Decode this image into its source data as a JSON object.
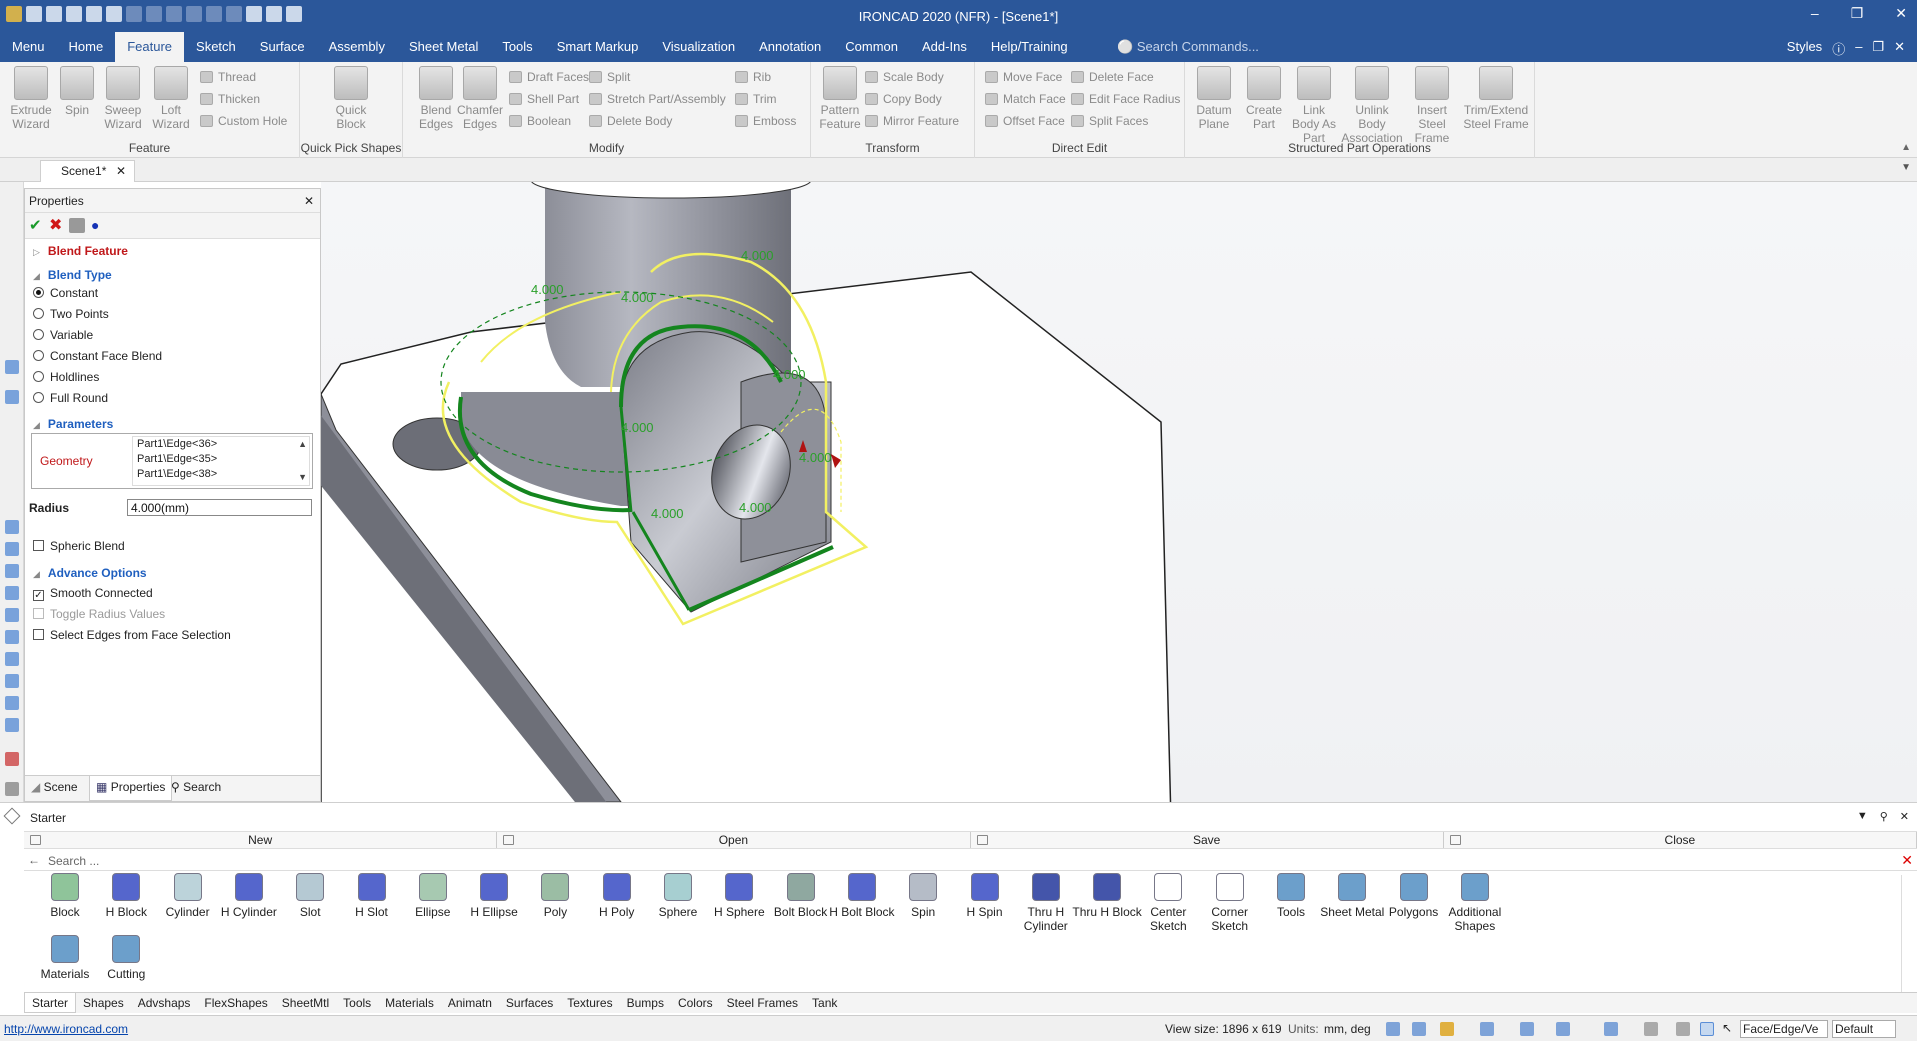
{
  "title": "IRONCAD 2020 (NFR) - [Scene1*]",
  "menu": {
    "tabs": [
      "Menu",
      "Home",
      "Feature",
      "Sketch",
      "Surface",
      "Assembly",
      "Sheet Metal",
      "Tools",
      "Smart Markup",
      "Visualization",
      "Annotation",
      "Common",
      "Add-Ins",
      "Help/Training"
    ],
    "active": "Feature",
    "search_placeholder": "Search Commands...",
    "styles": "Styles"
  },
  "ribbon": {
    "groups": {
      "feature": "Feature",
      "quick_pick": "Quick Pick Shapes",
      "modify": "Modify",
      "transform": "Transform",
      "direct_edit": "Direct Edit",
      "structured": "Structured Part Operations"
    },
    "feature_big": [
      "Extrude Wizard",
      "Spin",
      "Sweep Wizard",
      "Loft Wizard"
    ],
    "feature_small": [
      "Thread",
      "Thicken",
      "Custom Hole"
    ],
    "quick_block": "Quick Block",
    "modify_big": [
      "Blend Edges",
      "Chamfer Edges"
    ],
    "modify_small": [
      "Draft Faces",
      "Shell Part",
      "Boolean",
      "Split",
      "Stretch Part/Assembly",
      "Delete Body",
      "Rib",
      "Trim",
      "Emboss"
    ],
    "transform_big": "Pattern Feature",
    "transform_small": [
      "Scale Body",
      "Copy Body",
      "Mirror Feature"
    ],
    "direct_small": [
      "Move Face",
      "Match Face",
      "Offset Face",
      "Delete Face",
      "Edit Face Radius",
      "Split Faces"
    ],
    "structured_big": [
      "Datum Plane",
      "Create Part",
      "Link Body As Part",
      "Unlink Body Association",
      "Insert Steel Frame",
      "Trim/Extend Steel Frame"
    ]
  },
  "doc_tab": "Scene1*",
  "properties": {
    "title": "Properties",
    "blend_feature": "Blend Feature",
    "blend_type_head": "Blend Type",
    "blend_types": [
      "Constant",
      "Two Points",
      "Variable",
      "Constant Face Blend",
      "Holdlines",
      "Full Round"
    ],
    "selected_type": "Constant",
    "parameters_head": "Parameters",
    "geometry_label": "Geometry",
    "geometry_items": [
      "Part1\\Edge<36>",
      "Part1\\Edge<35>",
      "Part1\\Edge<38>"
    ],
    "radius_label": "Radius",
    "radius_value": "4.000(mm)",
    "spheric_blend": "Spheric Blend",
    "advance_head": "Advance Options",
    "smooth_connected": "Smooth Connected",
    "toggle_radius": "Toggle Radius Values",
    "select_edges": "Select Edges from Face Selection",
    "bottom_tabs": [
      "Scene",
      "Properties",
      "Search"
    ]
  },
  "viewport": {
    "dim_labels": [
      "4.000",
      "4.000",
      "4.000",
      "4.000",
      "4.000",
      "4.000",
      "4.000",
      "4.000"
    ]
  },
  "starter": {
    "title": "Starter",
    "actions": [
      "New",
      "Open",
      "Save",
      "Close"
    ],
    "search_placeholder": "Search ...",
    "shapes": [
      "Block",
      "H Block",
      "Cylinder",
      "H Cylinder",
      "Slot",
      "H Slot",
      "Ellipse",
      "H Ellipse",
      "Poly",
      "H Poly",
      "Sphere",
      "H Sphere",
      "Bolt Block",
      "H Bolt Block",
      "Spin",
      "H Spin",
      "Thru H Cylinder",
      "Thru H Block",
      "Center Sketch",
      "Corner Sketch",
      "Tools",
      "Sheet Metal",
      "Polygons",
      "Additional Shapes",
      "Materials",
      "Cutting"
    ],
    "categories": [
      "Starter",
      "Shapes",
      "Advshaps",
      "FlexShapes",
      "SheetMtl",
      "Tools",
      "Materials",
      "Animatn",
      "Surfaces",
      "Textures",
      "Bumps",
      "Colors",
      "Steel Frames",
      "Tank"
    ]
  },
  "status": {
    "url": "http://www.ironcad.com",
    "view_size": "View size: 1896 x  619",
    "units_label": "Units:",
    "units_value": "mm, deg",
    "selection_filter": "Face/Edge/Ve",
    "default": "Default"
  },
  "colors": {
    "titlebar": "#2b579a",
    "blend_red": "#c0181a",
    "section_blue": "#1f5fbf",
    "edge_green": "#14851e",
    "preview_yellow": "#f2f062"
  }
}
